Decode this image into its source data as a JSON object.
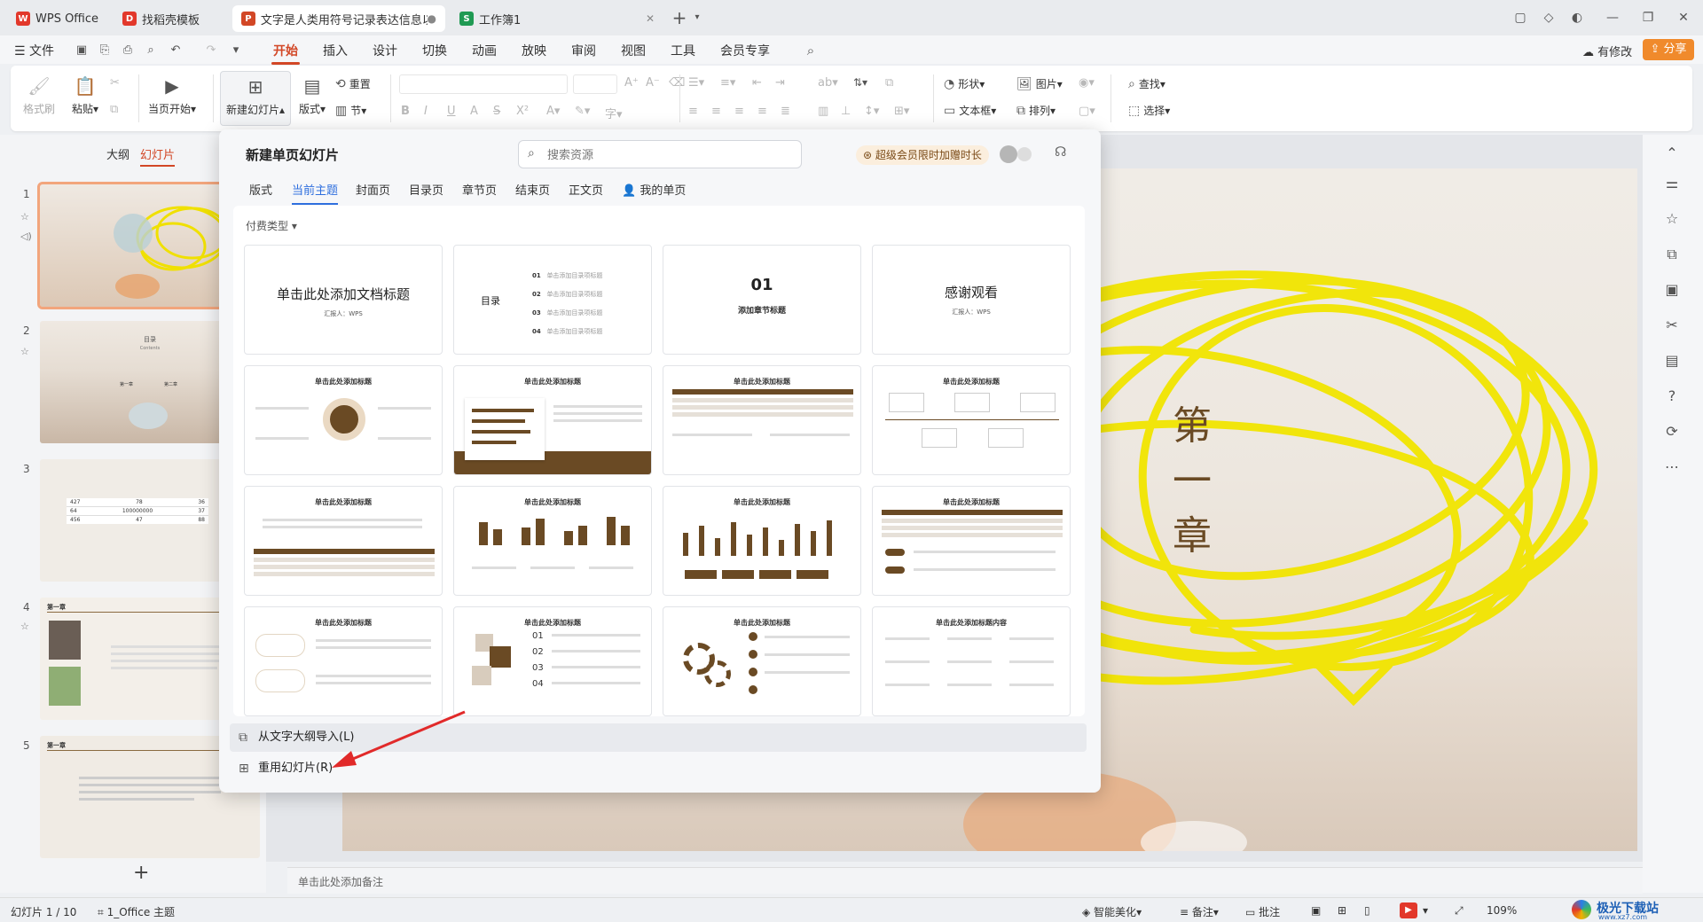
{
  "tabs": [
    {
      "label": "WPS Office",
      "color": "#e2382b",
      "icon": "W"
    },
    {
      "label": "找稻壳模板",
      "color": "#e2382b",
      "icon": "D"
    },
    {
      "label": "文字是人类用符号记录表达信息以",
      "color": "#d24726",
      "icon": "P"
    },
    {
      "label": "工作簿1",
      "color": "#1f9a53",
      "icon": "S"
    }
  ],
  "menu": {
    "file": "文件",
    "items": [
      "开始",
      "插入",
      "设计",
      "切换",
      "动画",
      "放映",
      "审阅",
      "视图",
      "工具",
      "会员专享"
    ],
    "modify": "有修改",
    "share": "分享"
  },
  "ribbon": {
    "format_painter": "格式刷",
    "paste": "粘贴",
    "play_current": "当页开始",
    "new_slide": "新建幻灯片",
    "layout": "版式",
    "section": "节",
    "reset": "重置",
    "shape": "形状",
    "picture": "图片",
    "find": "查找",
    "textbox": "文本框",
    "arrange": "排列",
    "select": "选择"
  },
  "left_panel": {
    "tab_outline": "大纲",
    "tab_slides": "幻灯片",
    "thumbs": [
      {
        "num": "1"
      },
      {
        "num": "2",
        "title": "目录",
        "sub": "Contents",
        "items": [
          "第一章",
          "第二章"
        ]
      },
      {
        "num": "3",
        "rows": [
          [
            "427",
            "78",
            "36"
          ],
          [
            "64",
            "100000000",
            "37"
          ],
          [
            "456",
            "47",
            "88"
          ]
        ]
      },
      {
        "num": "4",
        "heading": "第一章"
      },
      {
        "num": "5",
        "heading": "第一章"
      }
    ],
    "add": "+"
  },
  "slide": {
    "title_chars": [
      "第",
      "一",
      "章"
    ]
  },
  "notes_placeholder": "单击此处添加备注",
  "panel": {
    "title": "新建单页幻灯片",
    "search_placeholder": "搜索资源",
    "vip": "超级会员限时加赠时长",
    "tabs": [
      "版式",
      "当前主题",
      "封面页",
      "目录页",
      "章节页",
      "结束页",
      "正文页",
      "我的单页"
    ],
    "pay_type": "付费类型",
    "cards_row1": {
      "cover_title": "单击此处添加文档标题",
      "cover_sub": "汇报人：WPS",
      "toc_title": "目录",
      "toc_nums": [
        "01",
        "02",
        "03",
        "04"
      ],
      "toc_item": "单击添加目录项标题",
      "chapter_num": "01",
      "chapter_title": "添加章节标题",
      "end_title": "感谢观看",
      "end_sub": "汇报人：WPS"
    },
    "content_title": "单击此处添加标题",
    "content_title_long": "单击此处添加标题内容",
    "import_outline": "从文字大纲导入(L)",
    "reuse_slides": "重用幻灯片(R)"
  },
  "status": {
    "slide_pos": "幻灯片 1 / 10",
    "theme": "1_Office 主题",
    "beautify": "智能美化",
    "notes": "备注",
    "comment": "批注",
    "zoom": "109%"
  },
  "watermark": "极光下载站",
  "watermark_url": "www.xz7.com"
}
